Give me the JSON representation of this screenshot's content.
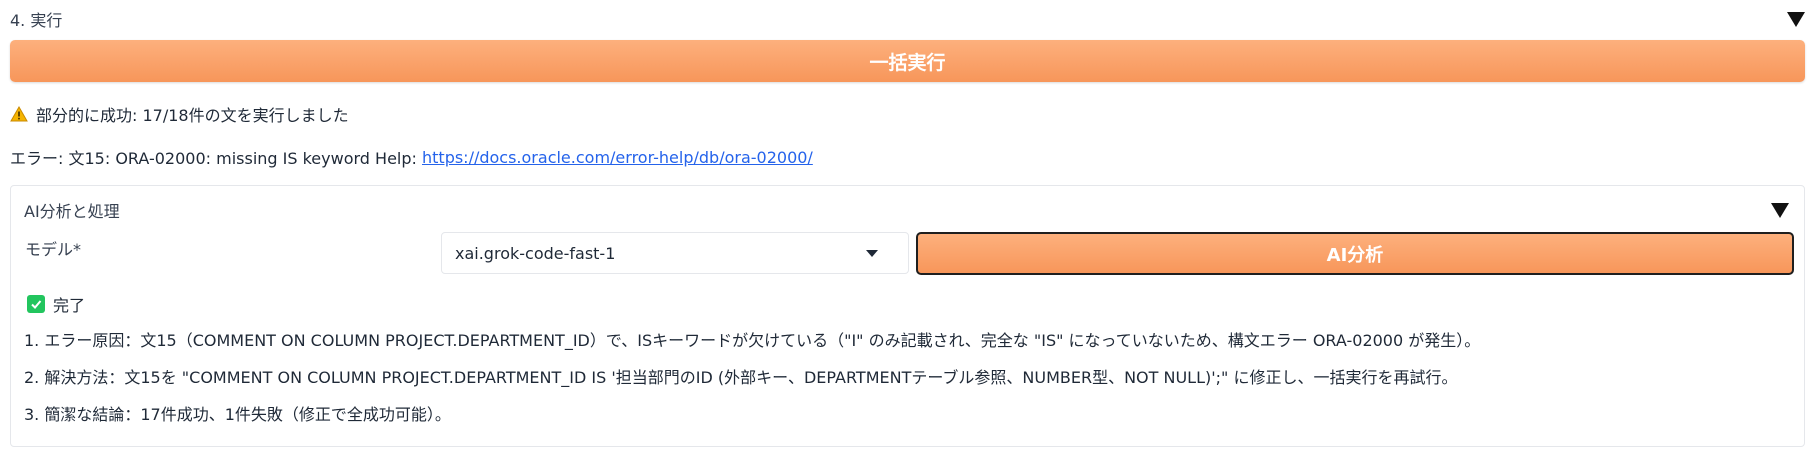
{
  "section": {
    "title": "4. 実行"
  },
  "run_all_button": {
    "label": "一括実行"
  },
  "status": {
    "message": "部分的に成功: 17/18件の文を実行しました"
  },
  "error": {
    "prefix": "エラー: 文15: ORA-02000: missing IS keyword Help: ",
    "link_text": "https://docs.oracle.com/error-help/db/ora-02000/"
  },
  "ai_panel": {
    "title": "AI分析と処理",
    "model_label": "モデル*",
    "model_value": "xai.grok-code-fast-1",
    "analyze_button": "AI分析",
    "done_label": "完了",
    "results": [
      "1. エラー原因：文15（COMMENT ON COLUMN PROJECT.DEPARTMENT_ID）で、ISキーワードが欠けている（\"I\" のみ記載され、完全な \"IS\" になっていないため、構文エラー ORA-02000 が発生）。",
      "2. 解決方法：文15を \"COMMENT ON COLUMN PROJECT.DEPARTMENT_ID IS '担当部門のID (外部キー、DEPARTMENTテーブル参照、NUMBER型、NOT NULL)';\" に修正し、一括実行を再試行。",
      "3. 簡潔な結論：17件成功、1件失敗（修正で全成功可能）。"
    ]
  },
  "icons": {
    "collapse": "triangle-down-icon",
    "warning": "warning-icon",
    "check": "check-icon",
    "dropdown": "chevron-down-icon"
  },
  "colors": {
    "accent_orange": "#f7965a",
    "link_blue": "#2563eb",
    "success_green": "#22c55e",
    "warning_yellow": "#f5b400"
  }
}
